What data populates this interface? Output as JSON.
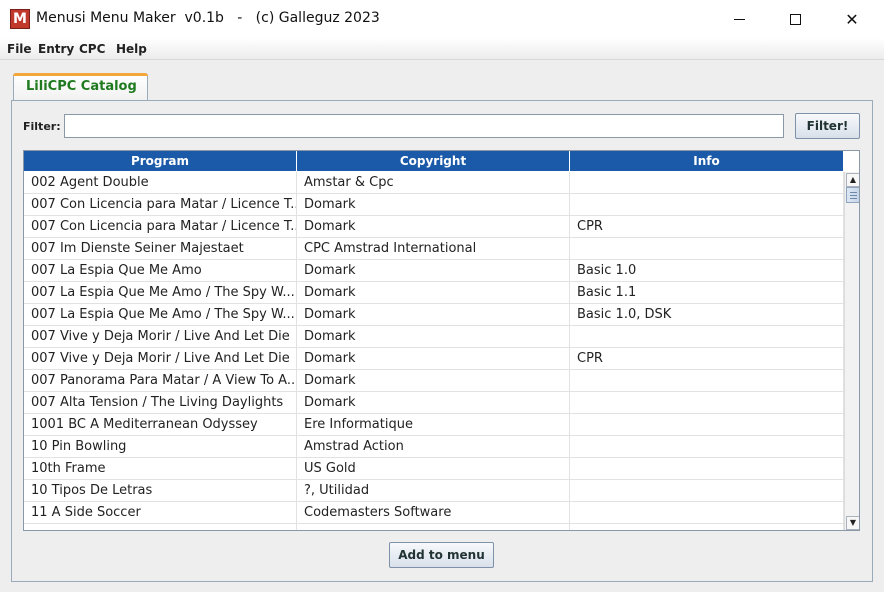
{
  "window": {
    "app_icon_letter": "M",
    "title": "Menusi Menu Maker  v0.1b   -   (c) Galleguz 2023",
    "minimize_label": "",
    "maximize_label": "",
    "close_label": "✕"
  },
  "menu": {
    "file": "File",
    "entry": "Entry",
    "cpc": "CPC",
    "help": "Help"
  },
  "tab": {
    "label": "LiliCPC Catalog"
  },
  "filter": {
    "label": "Filter:",
    "value": "",
    "button_label": "Filter!"
  },
  "table": {
    "columns": [
      "Program",
      "Copyright",
      "Info"
    ],
    "rows": [
      [
        "002 Agent Double",
        "Amstar & Cpc",
        ""
      ],
      [
        "007 Con Licencia para Matar / Licence T...",
        "Domark",
        ""
      ],
      [
        "007 Con Licencia para Matar / Licence T...",
        "Domark",
        "CPR"
      ],
      [
        "007 Im Dienste Seiner Majestaet",
        "CPC Amstrad International",
        ""
      ],
      [
        "007 La Espia Que Me Amo",
        "Domark",
        "Basic 1.0"
      ],
      [
        "007 La Espia Que Me Amo / The Spy W...",
        "Domark",
        "Basic 1.1"
      ],
      [
        "007 La Espia Que Me Amo / The Spy W...",
        "Domark",
        "Basic 1.0, DSK"
      ],
      [
        "007 Vive y Deja Morir / Live And Let Die",
        "Domark",
        ""
      ],
      [
        "007 Vive y Deja Morir / Live And Let Die",
        "Domark",
        "CPR"
      ],
      [
        "007 Panorama Para Matar / A View To A...",
        "Domark",
        ""
      ],
      [
        "007 Alta Tension / The Living Daylights",
        "Domark",
        ""
      ],
      [
        "1001 BC A Mediterranean Odyssey",
        "Ere Informatique",
        ""
      ],
      [
        "10 Pin Bowling",
        "Amstrad Action",
        ""
      ],
      [
        "10th Frame",
        "US Gold",
        ""
      ],
      [
        "10 Tipos De Letras",
        "?, Utilidad",
        ""
      ],
      [
        "11 A Side Soccer",
        "Codemasters Software",
        ""
      ],
      [
        "",
        "",
        ""
      ]
    ],
    "scroll_position": 0.02
  },
  "actions": {
    "add_to_menu_label": "Add to menu"
  },
  "colors": {
    "header_bg": "#1b5aa8",
    "tab_label": "#1f7a1f",
    "tab_accent": "#f3a63a",
    "app_icon": "#c0392b"
  }
}
